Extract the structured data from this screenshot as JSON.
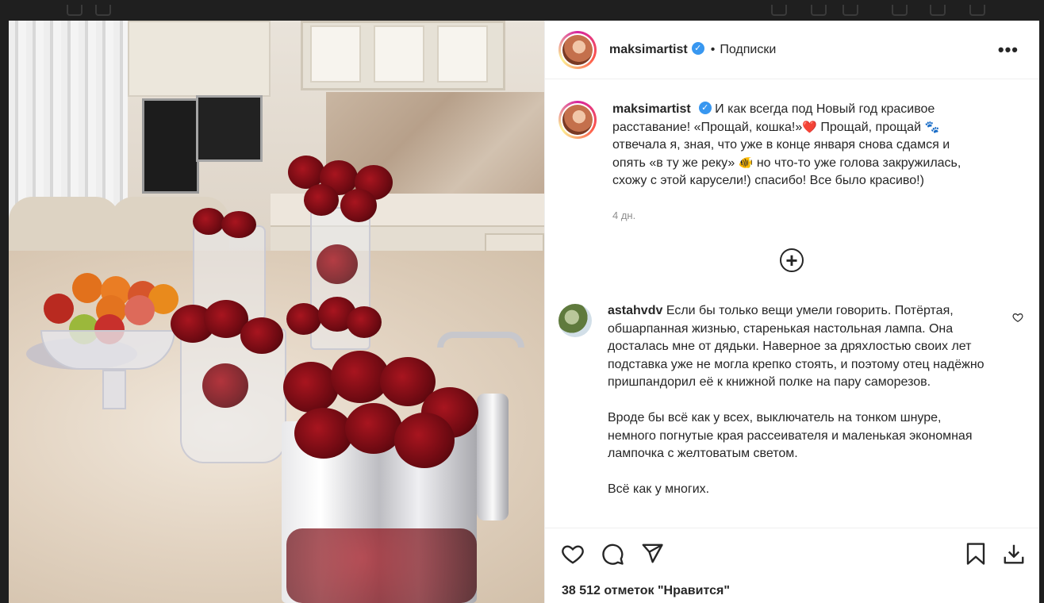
{
  "post": {
    "author": "maksimartist",
    "follow_status": "Подписки",
    "separator": "•",
    "more_icon": "more-horizontal-icon",
    "caption": {
      "text_part1": "И как всегда под Новый год красивое расставание! «Прощай, кошка!»",
      "emoji_heart": "❤️",
      "text_part2": " Прощай, прощай ",
      "emoji_paws": "🐾",
      "text_part3": " отвечала я, зная, что уже в конце января снова сдамся и опять «в ту же реку» ",
      "emoji_fish": "🐠",
      "text_part4": " но что-то уже голова закружилась, схожу с этой карусели!) спасибо! Все было красиво!)"
    },
    "time": "4 дн.",
    "likes": "38 512 отметок \"Нравится\""
  },
  "comments": [
    {
      "author": "astahvdv",
      "paragraphs": [
        "Если бы только вещи умели говорить. Потёртая, обшарпанная жизнью, старенькая настольная лампа. Она досталась мне от дядьки. Наверное за дряхлостью своих лет подставка уже не могла крепко стоять, и поэтому отец надёжно пришпандорил её к книжной полке на пару саморезов.",
        "Вроде бы всё как у всех, выключатель на тонком шнуре, немного погнутые края рассеивателя и маленькая экономная лампочка с желтоватым светом.",
        "Всё как у многих."
      ]
    }
  ],
  "icons": {
    "load_more": "plus-circle-icon",
    "like": "heart-icon",
    "comment": "comment-icon",
    "share": "send-icon",
    "save": "bookmark-icon",
    "download": "download-icon"
  },
  "colors": {
    "verified": "#3897f0",
    "text": "#262626",
    "secondary": "#8e8e8e"
  }
}
